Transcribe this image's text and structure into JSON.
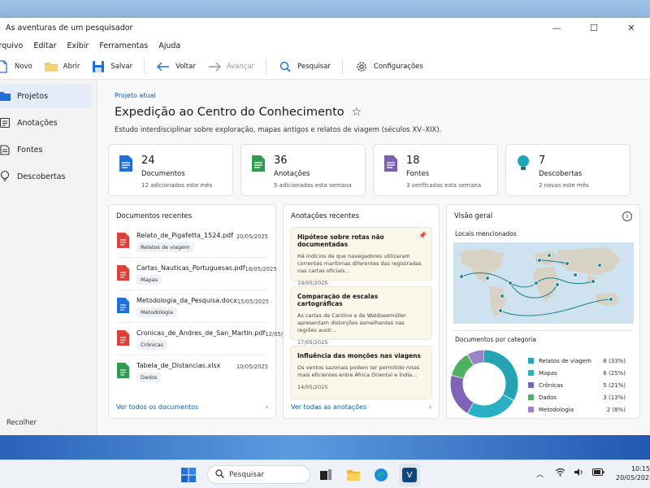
{
  "window": {
    "title": "As aventuras de um pesquisador",
    "min_symbol": "—",
    "max_symbol": "☐",
    "close_symbol": "✕"
  },
  "menu": [
    "Arquivo",
    "Editar",
    "Exibir",
    "Ferramentas",
    "Ajuda"
  ],
  "toolbar": {
    "novo": "Novo",
    "abrir": "Abrir",
    "salvar": "Salvar",
    "voltar": "Voltar",
    "avancar": "Avançar",
    "pesquisar": "Pesquisar",
    "configuracoes": "Configurações"
  },
  "sidebar": {
    "items": [
      {
        "label": "Projetos",
        "icon": "folder-icon"
      },
      {
        "label": "Anotações",
        "icon": "notes-icon"
      },
      {
        "label": "Fontes",
        "icon": "book-icon"
      },
      {
        "label": "Descobertas",
        "icon": "lightbulb-icon"
      }
    ],
    "collapse": "Recolher"
  },
  "project": {
    "crumb": "Projeto atual",
    "title": "Expedição ao Centro do Conhecimento",
    "description": "Estudo interdisciplinar sobre exploração, mapas antigos e relatos de viagem (séculos XV–XIX)."
  },
  "stats": [
    {
      "num": "24",
      "label": "Documentos",
      "sub": "12 adicionados este mês",
      "color": "#1e6fd9"
    },
    {
      "num": "36",
      "label": "Anotações",
      "sub": "5 adicionadas esta semana",
      "color": "#2e9b4f"
    },
    {
      "num": "18",
      "label": "Fontes",
      "sub": "3 verificadas esta semana",
      "color": "#7a5fb3"
    },
    {
      "num": "7",
      "label": "Descobertas",
      "sub": "2 novas este mês",
      "color": "#1aa7b8"
    }
  ],
  "docs": {
    "title": "Documentos recentes",
    "items": [
      {
        "name": "Relato_de_Pigafetta_1524.pdf",
        "tag": "Relatos de viagem",
        "date": "20/05/2025",
        "type": "pdf"
      },
      {
        "name": "Cartas_Nauticas_Portuguesas.pdf",
        "tag": "Mapas",
        "date": "18/05/2025",
        "type": "pdf"
      },
      {
        "name": "Metodologia_da_Pesquisa.docx",
        "tag": "Metodologia",
        "date": "15/05/2025",
        "type": "docx"
      },
      {
        "name": "Cronicas_de_Andres_de_San_Martin.pdf",
        "tag": "Crônicas",
        "date": "12/05/2025",
        "type": "pdf"
      },
      {
        "name": "Tabela_de_Distancias.xlsx",
        "tag": "Dados",
        "date": "10/05/2025",
        "type": "xlsx"
      }
    ],
    "link": "Ver todos os documentos"
  },
  "notes": {
    "title": "Anotações recentes",
    "items": [
      {
        "title": "Hipótese sobre rotas não documentadas",
        "body": "Há indícios de que navegadores utilizaram correntes marítimas diferentes das registradas nas cartas oficiais...",
        "date": "19/05/2025",
        "pinned": true
      },
      {
        "title": "Comparação de escalas cartográficas",
        "body": "As cartas de Cantino e de Waldseemüller apresentam distorções semelhantes nas regiões austr...",
        "date": "17/05/2025",
        "pinned": false
      },
      {
        "title": "Influência das monções nas viagens",
        "body": "Os ventos sazonais podem ter permitido rotas mais eficientes entre África Oriental e Índia...",
        "date": "14/05/2025",
        "pinned": false
      }
    ],
    "link": "Ver todas as anotações"
  },
  "overview": {
    "title": "Visão geral",
    "map_title": "Locais mencionados",
    "donut_title": "Documentos por categoria",
    "categories": [
      {
        "name": "Relatos de viagem",
        "value": "8 (33%)",
        "count": 8,
        "color": "#25a3b5"
      },
      {
        "name": "Mapas",
        "value": "6 (25%)",
        "count": 6,
        "color": "#2ab0c6"
      },
      {
        "name": "Crônicas",
        "value": "5 (21%)",
        "count": 5,
        "color": "#7d64b8"
      },
      {
        "name": "Dados",
        "value": "3 (13%)",
        "count": 3,
        "color": "#4fb061"
      },
      {
        "name": "Metodologia",
        "value": "2 (8%)",
        "count": 2,
        "color": "#9a82c9"
      }
    ]
  },
  "taskbar": {
    "search": "Pesquisar",
    "time": "10:15",
    "date": "20/05/2025"
  },
  "app_icon_letter": "V"
}
